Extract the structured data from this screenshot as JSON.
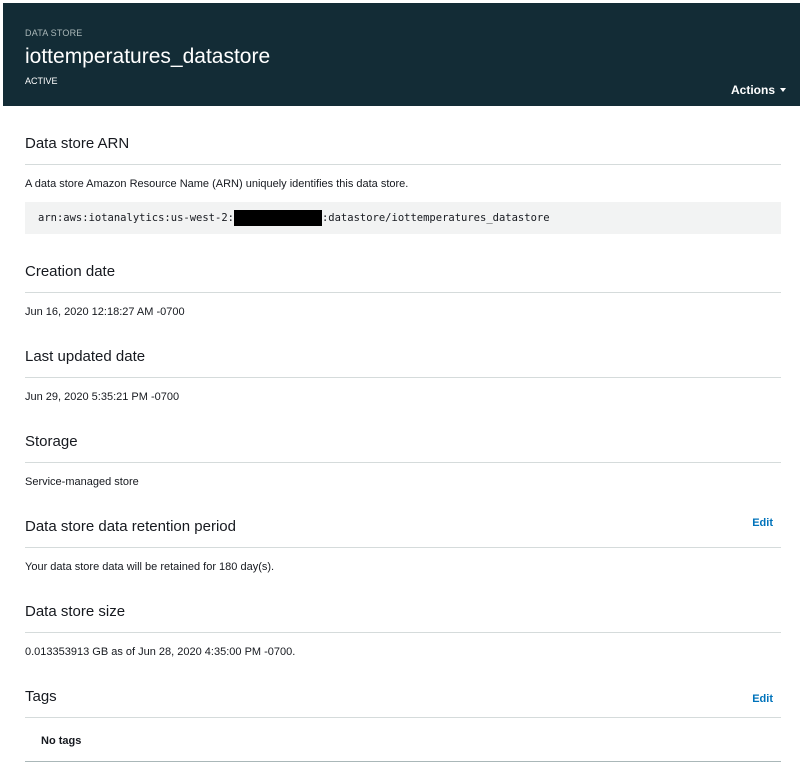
{
  "header": {
    "kicker": "DATA STORE",
    "title": "iottemperatures_datastore",
    "status": "ACTIVE",
    "actions_label": "Actions"
  },
  "arn": {
    "title": "Data store ARN",
    "description": "A data store Amazon Resource Name (ARN) uniquely identifies this data store.",
    "prefix": "arn:aws:iotanalytics:us-west-2:",
    "suffix": ":datastore/iottemperatures_datastore"
  },
  "creation": {
    "title": "Creation date",
    "value": "Jun 16, 2020 12:18:27 AM -0700"
  },
  "updated": {
    "title": "Last updated date",
    "value": "Jun 29, 2020 5:35:21 PM -0700"
  },
  "storage": {
    "title": "Storage",
    "value": "Service-managed store"
  },
  "retention": {
    "title": "Data store data retention period",
    "value": "Your data store data will be retained for 180 day(s).",
    "edit_label": "Edit"
  },
  "size": {
    "title": "Data store size",
    "value": "0.013353913 GB as of Jun 28, 2020 4:35:00 PM -0700."
  },
  "tags": {
    "title": "Tags",
    "empty_label": "No tags",
    "edit_label": "Edit"
  },
  "colors": {
    "header_bg": "#132c36",
    "link": "#0073bb",
    "divider": "#d5dbdb",
    "code_bg": "#f2f3f3"
  }
}
